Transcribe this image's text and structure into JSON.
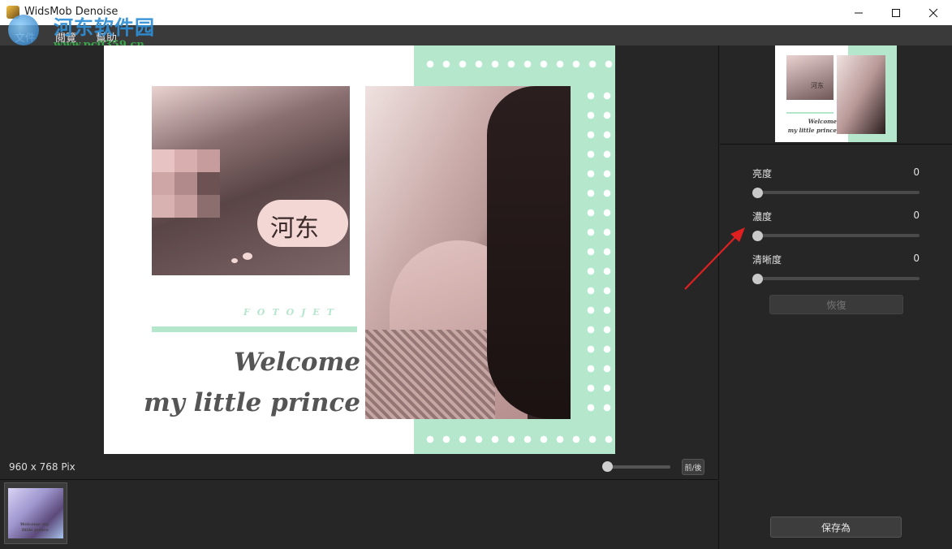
{
  "window": {
    "title": "WidsMob Denoise",
    "min_icon": "minimize-icon",
    "max_icon": "maximize-icon",
    "close_icon": "close-icon"
  },
  "watermark": {
    "line1": "河东软件园",
    "line2": "www.pc0359.cn"
  },
  "menu": {
    "items": [
      {
        "label": "文件"
      },
      {
        "label": "閱覽"
      },
      {
        "label": "幫助"
      }
    ]
  },
  "image": {
    "cloud_text": "河东",
    "brand_text": "FOTOJET",
    "welcome_line1": "Welcome",
    "welcome_line2": "my little prince"
  },
  "status": {
    "image_size": "960 x 768 Pix",
    "before_after_label": "前/後",
    "zoom_level": 0.05
  },
  "thumbnail": {
    "caption": "Welcome my little prince"
  },
  "preview": {
    "cloud_text": "河东",
    "welcome_line1": "Welcome",
    "welcome_line2": "my little prince"
  },
  "adjustments": {
    "sliders": [
      {
        "label": "亮度",
        "value": "0"
      },
      {
        "label": "濃度",
        "value": "0"
      },
      {
        "label": "清晰度",
        "value": "0"
      }
    ],
    "reset_label": "恢復",
    "save_label": "保存為"
  },
  "colors": {
    "accent_mint": "#b5e7cd",
    "panel_bg": "#262626",
    "arrow_red": "#e02020"
  }
}
